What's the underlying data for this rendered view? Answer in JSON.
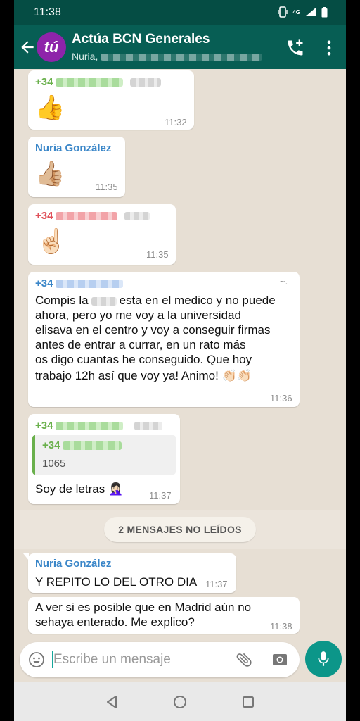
{
  "status_bar": {
    "time": "11:38",
    "network": "4G"
  },
  "header": {
    "title": "Actúa BCN Generales",
    "subtitle": "Nuria,",
    "avatar_text": "tú",
    "avatar_color": "#8e24aa"
  },
  "messages": [
    {
      "sender": "+34",
      "emoji": "👍",
      "time": "11:32"
    },
    {
      "sender": "Nuria González",
      "emoji": "👍🏼",
      "time": "11:35"
    },
    {
      "sender": "+34",
      "emoji": "☝🏻",
      "time": "11:35"
    },
    {
      "sender": "+34",
      "sender_suffix": "~.",
      "lines": [
        "Compis la",
        "esta en el medico y no puede",
        "ahora, pero yo me voy a la universidad",
        "elisava en el centro y voy a conseguir firmas",
        "antes de entrar a currar, en un rato más",
        "os digo cuantas he conseguido. Que hoy",
        "trabajo 12h así que voy ya! Animo! 👏🏻👏🏻"
      ],
      "time": "11:36"
    },
    {
      "sender": "+34",
      "quote_sender": "+34",
      "quote_text": "1065",
      "text": "Soy de letras 🤦🏻‍♀️",
      "time": "11:37"
    },
    {
      "sender": "Nuria González",
      "text": "Y REPITO LO DEL OTRO DIA",
      "time": "11:37"
    },
    {
      "lines": [
        "A ver si es posible que en Madrid aún no",
        "sehaya  enterado.  Me explico?"
      ],
      "time": "11:38"
    }
  ],
  "unread_label": "2 MENSAJES NO LEÍDOS",
  "input": {
    "placeholder": "Escribe un mensaje"
  },
  "icons": {
    "back": "arrow-left-icon",
    "add_call": "add-call-icon",
    "menu": "more-vert-icon",
    "emoji": "emoji-icon",
    "attach": "paperclip-icon",
    "camera": "camera-icon",
    "mic": "mic-icon"
  },
  "colors": {
    "header": "#075e54",
    "status_bar": "#054d44",
    "chat_bg": "#e7dfd4",
    "accent": "#0c9689"
  }
}
